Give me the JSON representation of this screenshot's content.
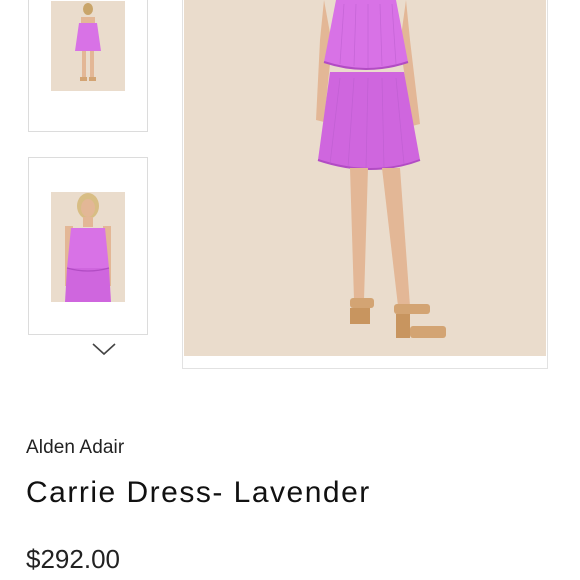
{
  "thumbnails": [
    {
      "icon": "dress-photo-full-length-icon"
    },
    {
      "icon": "dress-photo-upper-body-icon"
    }
  ],
  "carousel": {
    "next_icon": "chevron-down-icon"
  },
  "main_image": {
    "icon": "dress-photo-main-icon"
  },
  "product": {
    "brand": "Alden Adair",
    "title": "Carrie Dress- Lavender",
    "price": "$292.00"
  },
  "colors": {
    "dress": "#d872e6",
    "backdrop": "#eadccc",
    "skin": "#e3b796",
    "sandal": "#d3a473"
  }
}
